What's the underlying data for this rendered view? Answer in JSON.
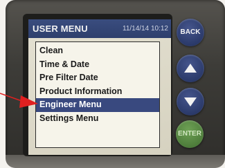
{
  "screen": {
    "title": "USER MENU",
    "datetime": "11/14/14 10:12"
  },
  "menu": {
    "items": [
      {
        "label": "Clean",
        "selected": false
      },
      {
        "label": "Time & Date",
        "selected": false
      },
      {
        "label": "Pre Filter Date",
        "selected": false
      },
      {
        "label": "Product Information",
        "selected": false
      },
      {
        "label": "Engineer Menu",
        "selected": true
      },
      {
        "label": "Settings Menu",
        "selected": false
      }
    ]
  },
  "buttons": {
    "back_label": "BACK",
    "up_icon": "up-arrow-icon",
    "down_icon": "down-arrow-icon",
    "enter_label": "ENTER"
  },
  "annotation": {
    "pointer_icon": "red-arrow-pointer-icon",
    "pointer_color": "#e02020"
  },
  "colors": {
    "header_bg": "#2e3f6d",
    "selection_bg": "#39497f",
    "nav_button": "#2b3a6a",
    "enter_button": "#4e7d3b"
  }
}
